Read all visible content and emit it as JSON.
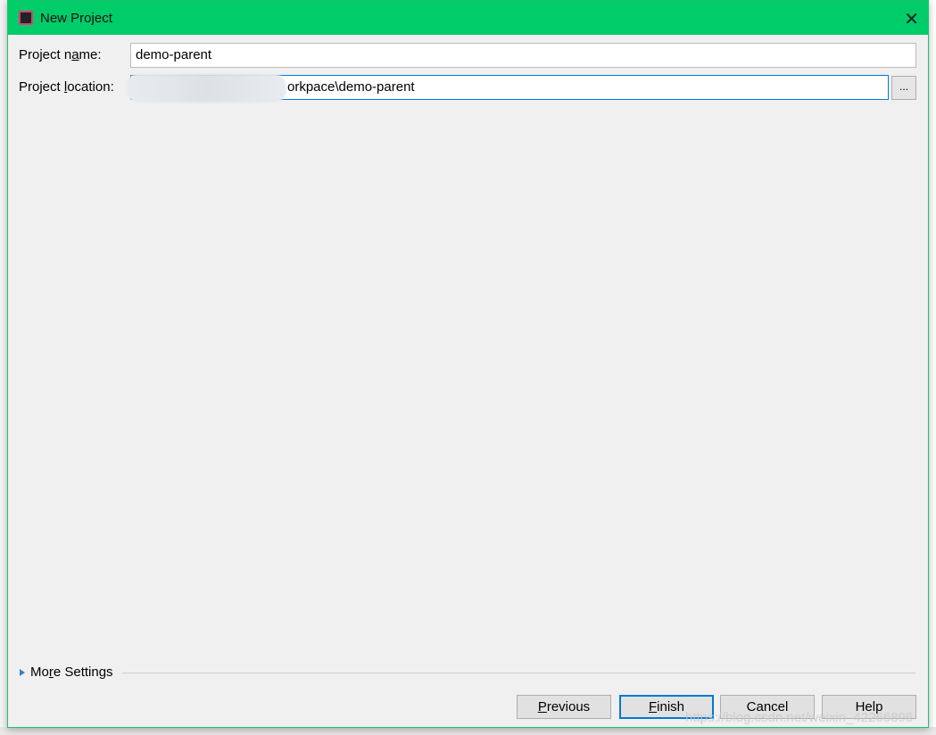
{
  "dialog": {
    "title": "New Project",
    "app_icon": "intellij-idea-icon",
    "close_icon": "close-icon"
  },
  "form": {
    "project_name_label_pre": "Project n",
    "project_name_label_u": "a",
    "project_name_label_post": "me:",
    "project_name_value": "demo-parent",
    "project_location_label_pre": "Project ",
    "project_location_label_u": "l",
    "project_location_label_post": "ocation:",
    "project_location_value": "orkpace\\demo-parent",
    "browse_label": "..."
  },
  "more_settings": {
    "pre": "Mo",
    "u": "r",
    "post": "e Settings"
  },
  "buttons": {
    "previous": {
      "u": "P",
      "rest": "revious"
    },
    "finish": {
      "u": "F",
      "rest": "inish"
    },
    "cancel": "Cancel",
    "help": "Help"
  },
  "watermark": "https://blog.csdn.net/weixin_42266896",
  "colors": {
    "titlebar": "#00cc6a",
    "default_button_border": "#0078d7"
  }
}
